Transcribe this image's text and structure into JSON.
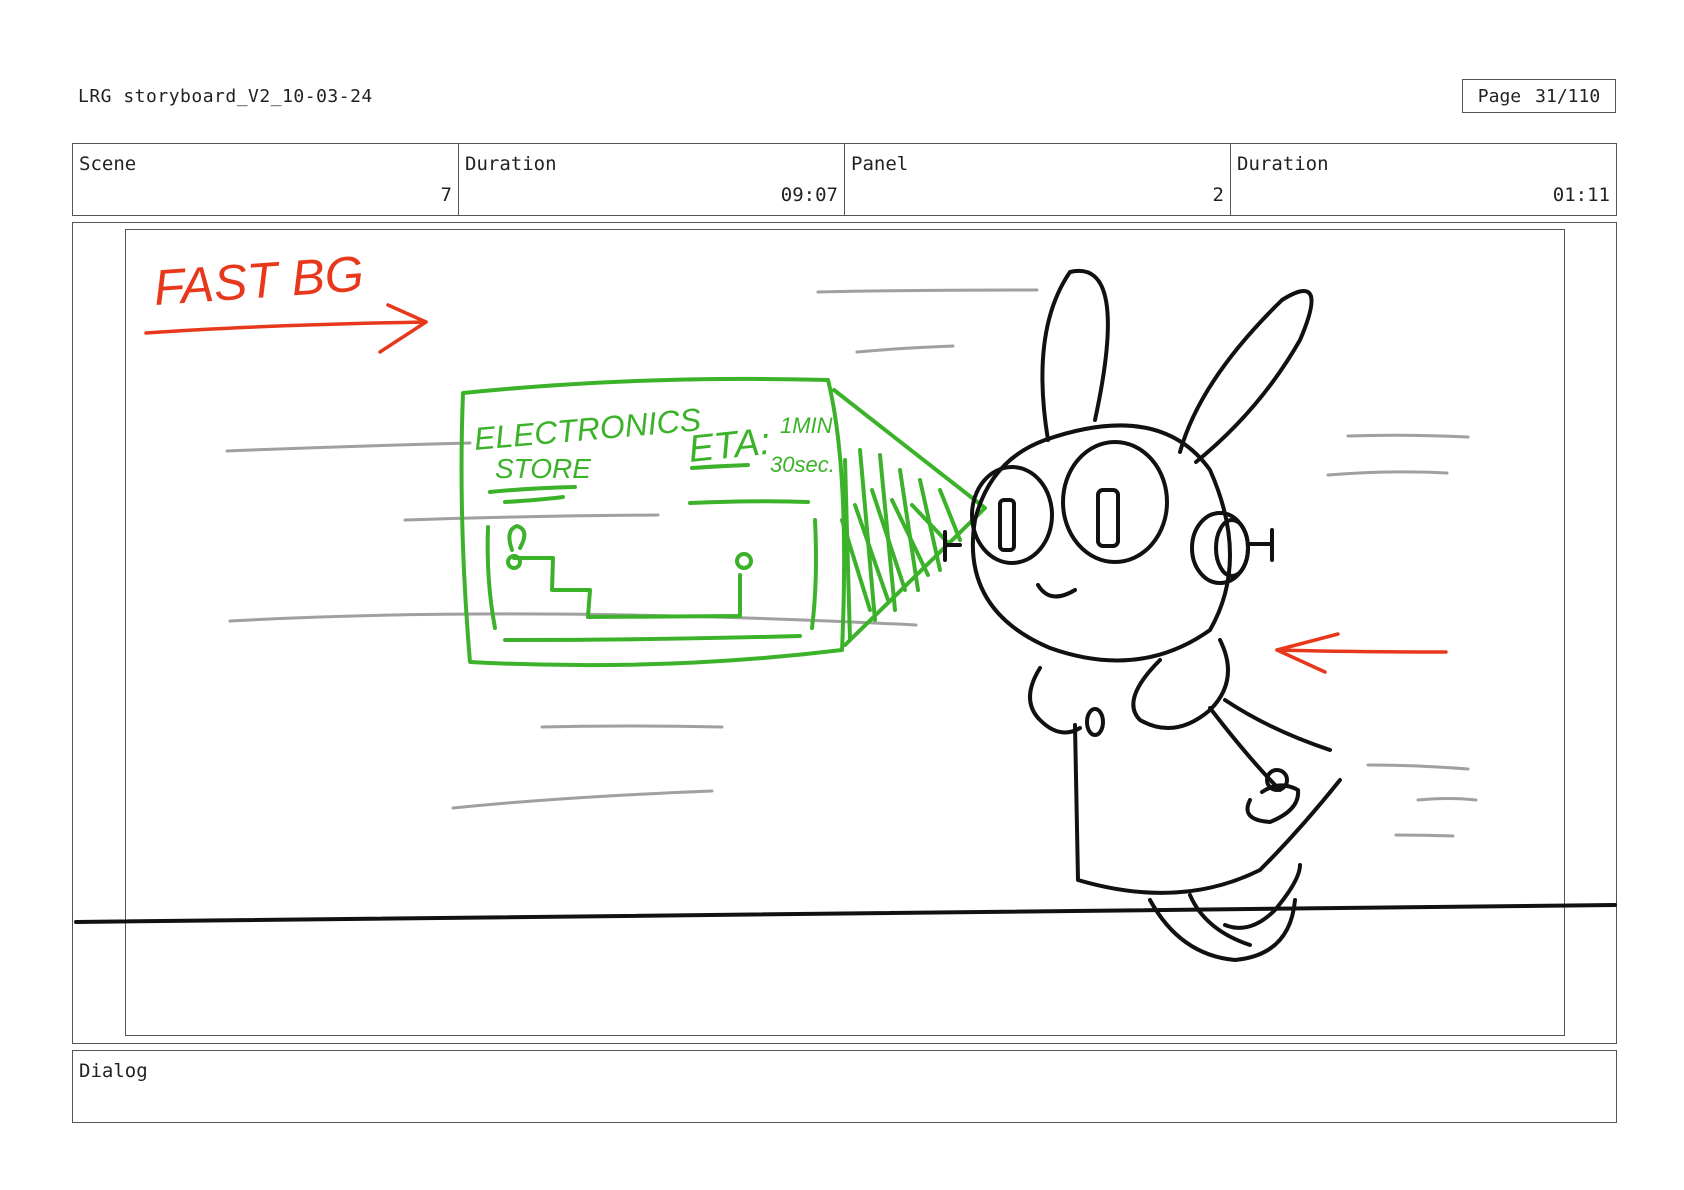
{
  "header": {
    "doc_title": "LRG storyboard_V2_10-03-24",
    "page_label": "Page",
    "page_number": "31/110"
  },
  "info": {
    "scene_label": "Scene",
    "scene_value": "7",
    "scene_duration_label": "Duration",
    "scene_duration_value": "09:07",
    "panel_label": "Panel",
    "panel_value": "2",
    "panel_duration_label": "Duration",
    "panel_duration_value": "01:11"
  },
  "sketch": {
    "note": "FAST BG",
    "screen_title_line1": "ELECTRONICS",
    "screen_title_line2": "STORE",
    "eta_label": "ETA:",
    "eta_line1": "1MIN",
    "eta_line2": "30sec.",
    "colors": {
      "annotation": "#e8381c",
      "hologram": "#3bb22a",
      "speed_lines": "#a0a0a0",
      "ink": "#111111"
    }
  },
  "dialog": {
    "label": "Dialog",
    "text": ""
  }
}
